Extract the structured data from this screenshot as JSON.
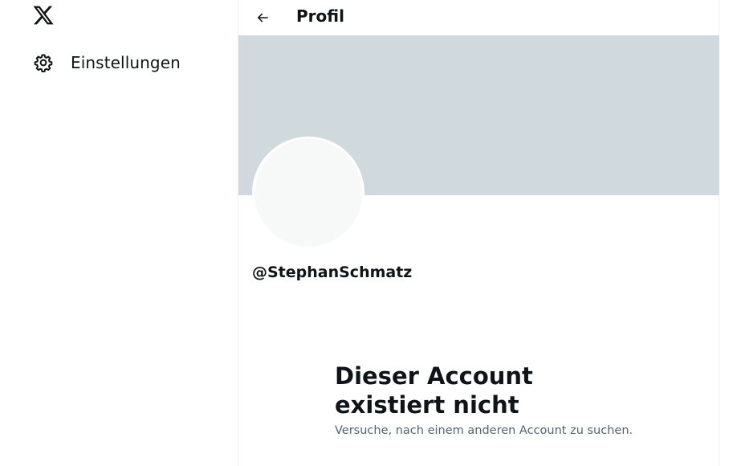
{
  "sidebar": {
    "logo_icon": "x-logo-icon",
    "items": [
      {
        "label": "Einstellungen",
        "icon": "gear-icon"
      }
    ]
  },
  "header": {
    "back_icon": "arrow-left-icon",
    "title": "Profil"
  },
  "profile": {
    "handle": "@StephanSchmatz",
    "banner_color": "#cfd9de",
    "avatar_color": "#f7f9f9"
  },
  "empty_state": {
    "title_line1": "Dieser Account",
    "title_line2": "existiert nicht",
    "subtitle": "Versuche, nach einem anderen Account zu suchen."
  }
}
